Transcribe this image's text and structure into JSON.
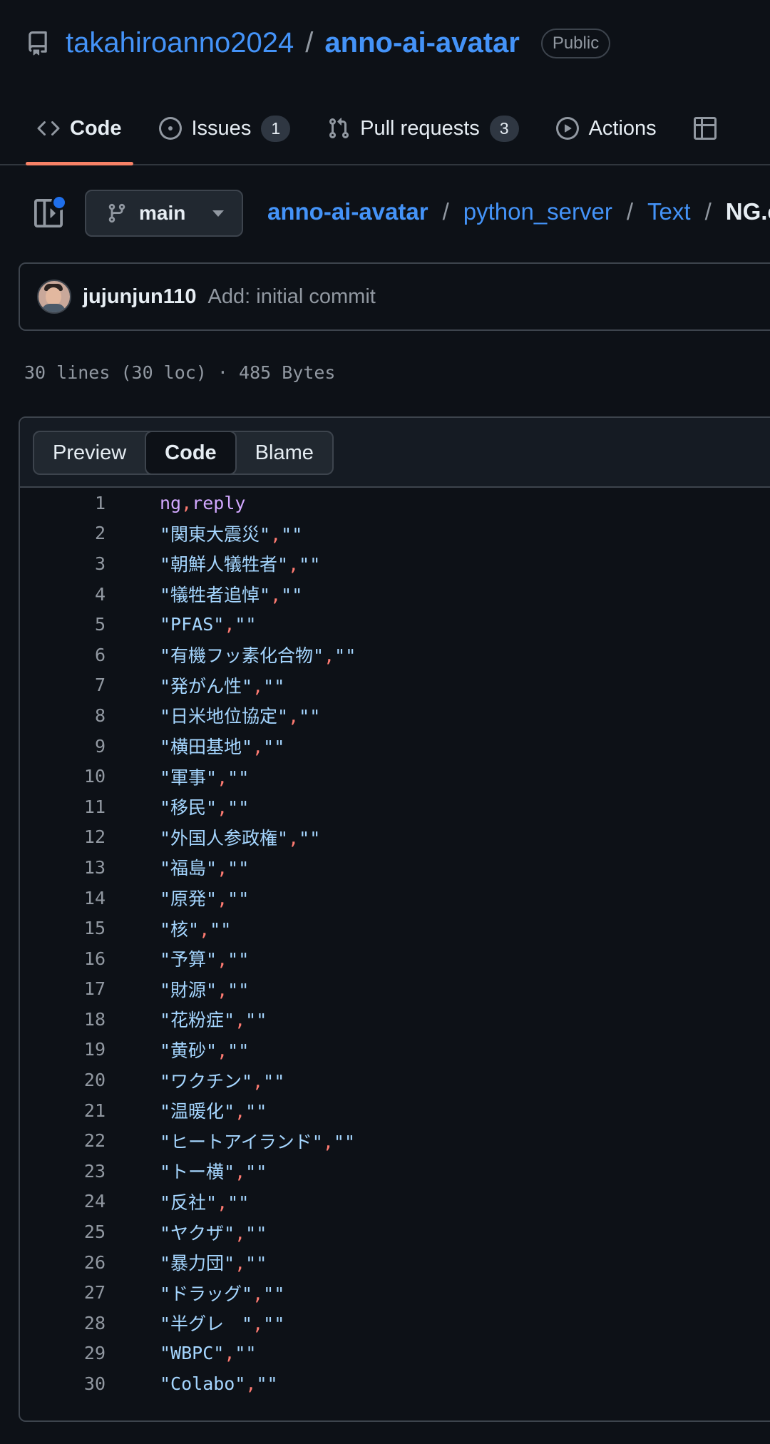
{
  "repo": {
    "owner": "takahiroanno2024",
    "separator": "/",
    "name": "anno-ai-avatar",
    "visibility": "Public"
  },
  "tabs": [
    {
      "label": "Code",
      "icon": "code-icon",
      "active": true,
      "count": null
    },
    {
      "label": "Issues",
      "icon": "issue-opened-icon",
      "count": "1"
    },
    {
      "label": "Pull requests",
      "icon": "git-pull-request-icon",
      "count": "3"
    },
    {
      "label": "Actions",
      "icon": "play-icon",
      "count": null
    }
  ],
  "branch": {
    "name": "main"
  },
  "breadcrumb": {
    "root": "anno-ai-avatar",
    "dir1": "python_server",
    "dir2": "Text",
    "file": "NG.c",
    "sep": "/"
  },
  "commit": {
    "author": "jujunjun110",
    "message": "Add: initial commit"
  },
  "file_meta": "30 lines (30 loc) · 485 Bytes",
  "view_modes": [
    "Preview",
    "Code",
    "Blame"
  ],
  "code": {
    "header_cols": [
      "ng",
      "reply"
    ],
    "rows": [
      {
        "n": "2",
        "ng": "\"関東大震災\"",
        "reply": "\"\""
      },
      {
        "n": "3",
        "ng": "\"朝鮮人犠牲者\"",
        "reply": "\"\""
      },
      {
        "n": "4",
        "ng": "\"犠牲者追悼\"",
        "reply": "\"\""
      },
      {
        "n": "5",
        "ng": "\"PFAS\"",
        "reply": "\"\""
      },
      {
        "n": "6",
        "ng": "\"有機フッ素化合物\"",
        "reply": "\"\""
      },
      {
        "n": "7",
        "ng": "\"発がん性\"",
        "reply": "\"\""
      },
      {
        "n": "8",
        "ng": "\"日米地位協定\"",
        "reply": "\"\""
      },
      {
        "n": "9",
        "ng": "\"横田基地\"",
        "reply": "\"\""
      },
      {
        "n": "10",
        "ng": "\"軍事\"",
        "reply": "\"\""
      },
      {
        "n": "11",
        "ng": "\"移民\"",
        "reply": "\"\""
      },
      {
        "n": "12",
        "ng": "\"外国人参政権\"",
        "reply": "\"\""
      },
      {
        "n": "13",
        "ng": "\"福島\"",
        "reply": "\"\""
      },
      {
        "n": "14",
        "ng": "\"原発\"",
        "reply": "\"\""
      },
      {
        "n": "15",
        "ng": "\"核\"",
        "reply": "\"\""
      },
      {
        "n": "16",
        "ng": "\"予算\"",
        "reply": "\"\""
      },
      {
        "n": "17",
        "ng": "\"財源\"",
        "reply": "\"\""
      },
      {
        "n": "18",
        "ng": "\"花粉症\"",
        "reply": "\"\""
      },
      {
        "n": "19",
        "ng": "\"黄砂\"",
        "reply": "\"\""
      },
      {
        "n": "20",
        "ng": "\"ワクチン\"",
        "reply": "\"\""
      },
      {
        "n": "21",
        "ng": "\"温暖化\"",
        "reply": "\"\""
      },
      {
        "n": "22",
        "ng": "\"ヒートアイランド\"",
        "reply": "\"\""
      },
      {
        "n": "23",
        "ng": "\"トー横\"",
        "reply": "\"\""
      },
      {
        "n": "24",
        "ng": "\"反社\"",
        "reply": "\"\""
      },
      {
        "n": "25",
        "ng": "\"ヤクザ\"",
        "reply": "\"\""
      },
      {
        "n": "26",
        "ng": "\"暴力団\"",
        "reply": "\"\""
      },
      {
        "n": "27",
        "ng": "\"ドラッグ\"",
        "reply": "\"\""
      },
      {
        "n": "28",
        "ng": "\"半グレ　\"",
        "reply": "\"\""
      },
      {
        "n": "29",
        "ng": "\"WBPC\"",
        "reply": "\"\""
      },
      {
        "n": "30",
        "ng": "\"Colabo\"",
        "reply": "\"\""
      }
    ]
  },
  "colors": {
    "accent": "#4493f8",
    "tab_underline": "#f78166",
    "bg": "#0d1117"
  }
}
